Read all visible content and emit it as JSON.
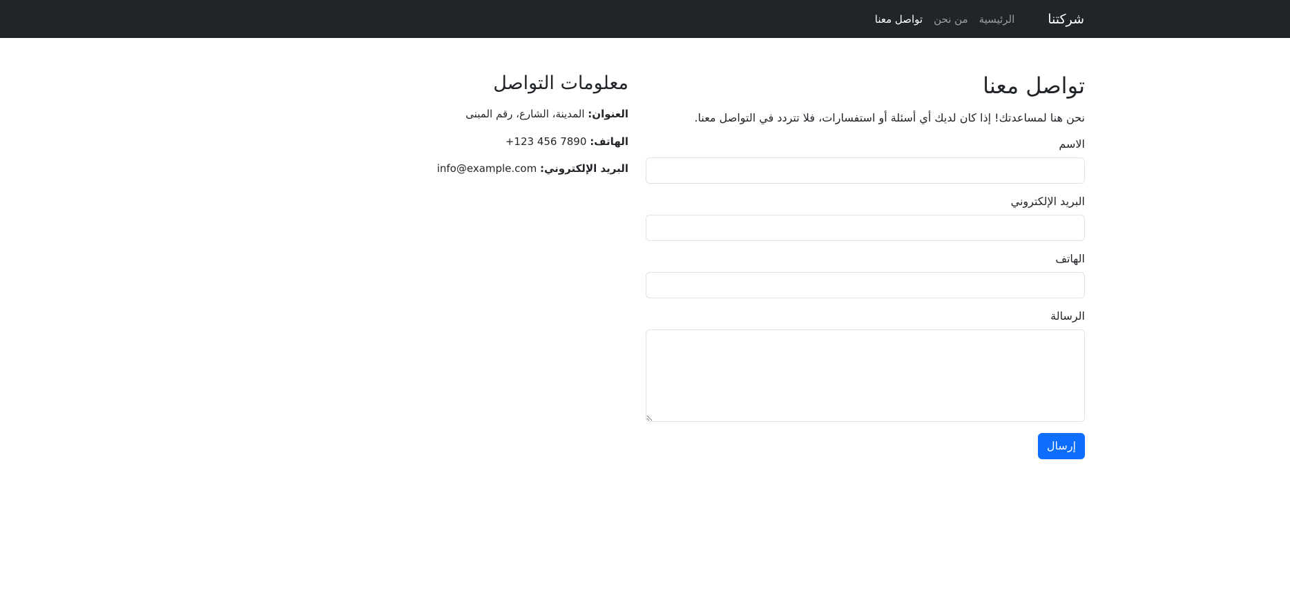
{
  "navbar": {
    "brand": "شركتنا",
    "links": [
      {
        "label": "الرئيسية",
        "active": false
      },
      {
        "label": "من نحن",
        "active": false
      },
      {
        "label": "تواصل معنا",
        "active": true
      }
    ]
  },
  "form": {
    "title": "تواصل معنا",
    "intro": "نحن هنا لمساعدتك! إذا كان لديك أي أسئلة أو استفسارات، فلا تتردد في التواصل معنا.",
    "fields": {
      "name_label": "الاسم",
      "email_label": "البريد الإلكتروني",
      "phone_label": "الهاتف",
      "message_label": "الرسالة"
    },
    "submit_label": "إرسال"
  },
  "info": {
    "title": "معلومات التواصل",
    "address_label": "العنوان:",
    "address_value": "المدينة، الشارع، رقم المبنى",
    "phone_label": "الهاتف:",
    "phone_value": "+123 456 7890",
    "email_label": "البريد الإلكتروني:",
    "email_value": "info@example.com"
  },
  "colors": {
    "navbar_bg": "#212529",
    "primary": "#0d6efd"
  }
}
